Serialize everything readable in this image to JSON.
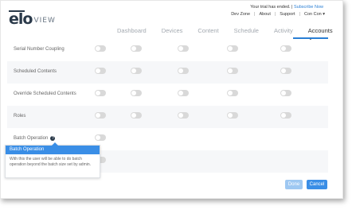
{
  "brand": {
    "name": "elo",
    "sub": "VIEW"
  },
  "header": {
    "trial_text": "Your trial has ended.",
    "separator": "|",
    "subscribe_link": "Subscribe Now",
    "links": [
      "Dev Zone",
      "About",
      "Support",
      "Con Con ▾"
    ]
  },
  "nav": {
    "tabs": [
      "Dashboard",
      "Devices",
      "Content",
      "Schedule",
      "Activity"
    ],
    "active_tab": "Accounts ⌄"
  },
  "rows": [
    {
      "label": "Serial Number Coupling"
    },
    {
      "label": "Scheduled Contents"
    },
    {
      "label": "Override Scheduled Contents"
    },
    {
      "label": "Roles"
    },
    {
      "label": "Batch Operation"
    }
  ],
  "tooltip": {
    "title": "Batch Operation",
    "text": "With this the user will be able to do batch operation beyond the batch size set by admin."
  },
  "footer": {
    "done_label": "Done",
    "cancel_label": "Cancel"
  },
  "colors": {
    "accent": "#3a8ee6",
    "toggle_off": "#d9d9d9",
    "row_alt": "#f6f7f9"
  }
}
